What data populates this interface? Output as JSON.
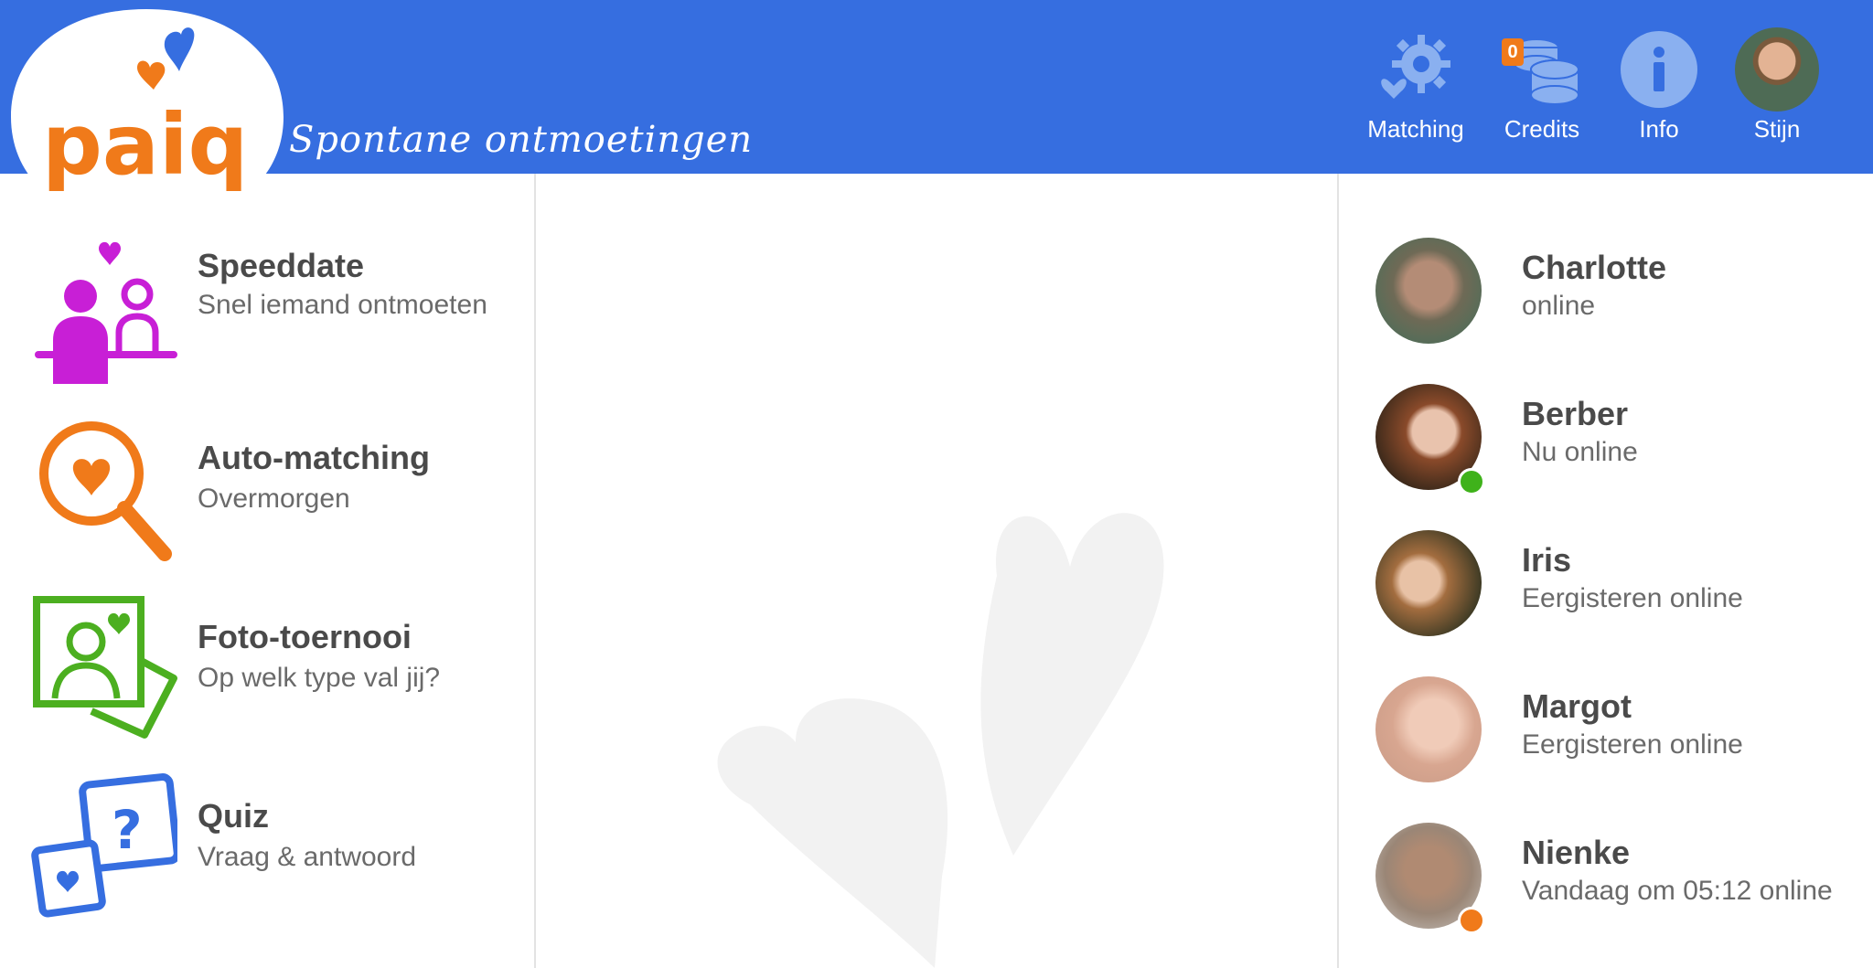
{
  "brand": {
    "logo_text": "paiq",
    "tagline": "Spontane ontmoetingen",
    "header_color": "#366ee0"
  },
  "nav": {
    "matching": {
      "label": "Matching",
      "icon": "gear-heart-icon"
    },
    "credits": {
      "label": "Credits",
      "icon": "coins-icon",
      "count": "0"
    },
    "info": {
      "label": "Info",
      "icon": "info-icon"
    },
    "profile": {
      "label": "Stijn",
      "icon": "avatar"
    }
  },
  "menu": [
    {
      "title": "Speeddate",
      "subtitle": "Snel iemand ontmoeten",
      "icon": "speeddate-icon",
      "color": "#c81fd6"
    },
    {
      "title": "Auto-matching",
      "subtitle": "Overmorgen",
      "icon": "magnifier-heart-icon",
      "color": "#f07a1a"
    },
    {
      "title": "Foto-toernooi",
      "subtitle": "Op welk type val jij?",
      "icon": "photo-tournament-icon",
      "color": "#4caf20"
    },
    {
      "title": "Quiz",
      "subtitle": "Vraag & antwoord",
      "icon": "quiz-dice-icon",
      "color": "#366ee0"
    }
  ],
  "contacts": [
    {
      "name": "Charlotte",
      "status": "online",
      "dot": ""
    },
    {
      "name": "Berber",
      "status": "Nu online",
      "dot": "#3fb21a"
    },
    {
      "name": "Iris",
      "status": "Eergisteren online",
      "dot": ""
    },
    {
      "name": "Margot",
      "status": "Eergisteren online",
      "dot": ""
    },
    {
      "name": "Nienke",
      "status": "Vandaag om 05:12 online",
      "dot": "#f07a1a"
    }
  ]
}
